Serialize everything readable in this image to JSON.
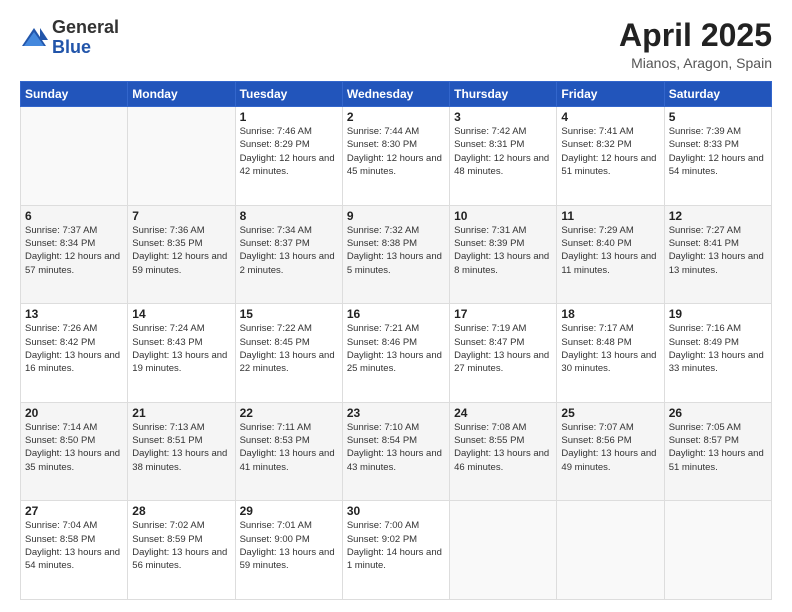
{
  "logo": {
    "general": "General",
    "blue": "Blue"
  },
  "header": {
    "title": "April 2025",
    "subtitle": "Mianos, Aragon, Spain"
  },
  "calendar": {
    "days_of_week": [
      "Sunday",
      "Monday",
      "Tuesday",
      "Wednesday",
      "Thursday",
      "Friday",
      "Saturday"
    ],
    "weeks": [
      [
        {
          "day": "",
          "sunrise": "",
          "sunset": "",
          "daylight": ""
        },
        {
          "day": "",
          "sunrise": "",
          "sunset": "",
          "daylight": ""
        },
        {
          "day": "1",
          "sunrise": "Sunrise: 7:46 AM",
          "sunset": "Sunset: 8:29 PM",
          "daylight": "Daylight: 12 hours and 42 minutes."
        },
        {
          "day": "2",
          "sunrise": "Sunrise: 7:44 AM",
          "sunset": "Sunset: 8:30 PM",
          "daylight": "Daylight: 12 hours and 45 minutes."
        },
        {
          "day": "3",
          "sunrise": "Sunrise: 7:42 AM",
          "sunset": "Sunset: 8:31 PM",
          "daylight": "Daylight: 12 hours and 48 minutes."
        },
        {
          "day": "4",
          "sunrise": "Sunrise: 7:41 AM",
          "sunset": "Sunset: 8:32 PM",
          "daylight": "Daylight: 12 hours and 51 minutes."
        },
        {
          "day": "5",
          "sunrise": "Sunrise: 7:39 AM",
          "sunset": "Sunset: 8:33 PM",
          "daylight": "Daylight: 12 hours and 54 minutes."
        }
      ],
      [
        {
          "day": "6",
          "sunrise": "Sunrise: 7:37 AM",
          "sunset": "Sunset: 8:34 PM",
          "daylight": "Daylight: 12 hours and 57 minutes."
        },
        {
          "day": "7",
          "sunrise": "Sunrise: 7:36 AM",
          "sunset": "Sunset: 8:35 PM",
          "daylight": "Daylight: 12 hours and 59 minutes."
        },
        {
          "day": "8",
          "sunrise": "Sunrise: 7:34 AM",
          "sunset": "Sunset: 8:37 PM",
          "daylight": "Daylight: 13 hours and 2 minutes."
        },
        {
          "day": "9",
          "sunrise": "Sunrise: 7:32 AM",
          "sunset": "Sunset: 8:38 PM",
          "daylight": "Daylight: 13 hours and 5 minutes."
        },
        {
          "day": "10",
          "sunrise": "Sunrise: 7:31 AM",
          "sunset": "Sunset: 8:39 PM",
          "daylight": "Daylight: 13 hours and 8 minutes."
        },
        {
          "day": "11",
          "sunrise": "Sunrise: 7:29 AM",
          "sunset": "Sunset: 8:40 PM",
          "daylight": "Daylight: 13 hours and 11 minutes."
        },
        {
          "day": "12",
          "sunrise": "Sunrise: 7:27 AM",
          "sunset": "Sunset: 8:41 PM",
          "daylight": "Daylight: 13 hours and 13 minutes."
        }
      ],
      [
        {
          "day": "13",
          "sunrise": "Sunrise: 7:26 AM",
          "sunset": "Sunset: 8:42 PM",
          "daylight": "Daylight: 13 hours and 16 minutes."
        },
        {
          "day": "14",
          "sunrise": "Sunrise: 7:24 AM",
          "sunset": "Sunset: 8:43 PM",
          "daylight": "Daylight: 13 hours and 19 minutes."
        },
        {
          "day": "15",
          "sunrise": "Sunrise: 7:22 AM",
          "sunset": "Sunset: 8:45 PM",
          "daylight": "Daylight: 13 hours and 22 minutes."
        },
        {
          "day": "16",
          "sunrise": "Sunrise: 7:21 AM",
          "sunset": "Sunset: 8:46 PM",
          "daylight": "Daylight: 13 hours and 25 minutes."
        },
        {
          "day": "17",
          "sunrise": "Sunrise: 7:19 AM",
          "sunset": "Sunset: 8:47 PM",
          "daylight": "Daylight: 13 hours and 27 minutes."
        },
        {
          "day": "18",
          "sunrise": "Sunrise: 7:17 AM",
          "sunset": "Sunset: 8:48 PM",
          "daylight": "Daylight: 13 hours and 30 minutes."
        },
        {
          "day": "19",
          "sunrise": "Sunrise: 7:16 AM",
          "sunset": "Sunset: 8:49 PM",
          "daylight": "Daylight: 13 hours and 33 minutes."
        }
      ],
      [
        {
          "day": "20",
          "sunrise": "Sunrise: 7:14 AM",
          "sunset": "Sunset: 8:50 PM",
          "daylight": "Daylight: 13 hours and 35 minutes."
        },
        {
          "day": "21",
          "sunrise": "Sunrise: 7:13 AM",
          "sunset": "Sunset: 8:51 PM",
          "daylight": "Daylight: 13 hours and 38 minutes."
        },
        {
          "day": "22",
          "sunrise": "Sunrise: 7:11 AM",
          "sunset": "Sunset: 8:53 PM",
          "daylight": "Daylight: 13 hours and 41 minutes."
        },
        {
          "day": "23",
          "sunrise": "Sunrise: 7:10 AM",
          "sunset": "Sunset: 8:54 PM",
          "daylight": "Daylight: 13 hours and 43 minutes."
        },
        {
          "day": "24",
          "sunrise": "Sunrise: 7:08 AM",
          "sunset": "Sunset: 8:55 PM",
          "daylight": "Daylight: 13 hours and 46 minutes."
        },
        {
          "day": "25",
          "sunrise": "Sunrise: 7:07 AM",
          "sunset": "Sunset: 8:56 PM",
          "daylight": "Daylight: 13 hours and 49 minutes."
        },
        {
          "day": "26",
          "sunrise": "Sunrise: 7:05 AM",
          "sunset": "Sunset: 8:57 PM",
          "daylight": "Daylight: 13 hours and 51 minutes."
        }
      ],
      [
        {
          "day": "27",
          "sunrise": "Sunrise: 7:04 AM",
          "sunset": "Sunset: 8:58 PM",
          "daylight": "Daylight: 13 hours and 54 minutes."
        },
        {
          "day": "28",
          "sunrise": "Sunrise: 7:02 AM",
          "sunset": "Sunset: 8:59 PM",
          "daylight": "Daylight: 13 hours and 56 minutes."
        },
        {
          "day": "29",
          "sunrise": "Sunrise: 7:01 AM",
          "sunset": "Sunset: 9:00 PM",
          "daylight": "Daylight: 13 hours and 59 minutes."
        },
        {
          "day": "30",
          "sunrise": "Sunrise: 7:00 AM",
          "sunset": "Sunset: 9:02 PM",
          "daylight": "Daylight: 14 hours and 1 minute."
        },
        {
          "day": "",
          "sunrise": "",
          "sunset": "",
          "daylight": ""
        },
        {
          "day": "",
          "sunrise": "",
          "sunset": "",
          "daylight": ""
        },
        {
          "day": "",
          "sunrise": "",
          "sunset": "",
          "daylight": ""
        }
      ]
    ]
  }
}
